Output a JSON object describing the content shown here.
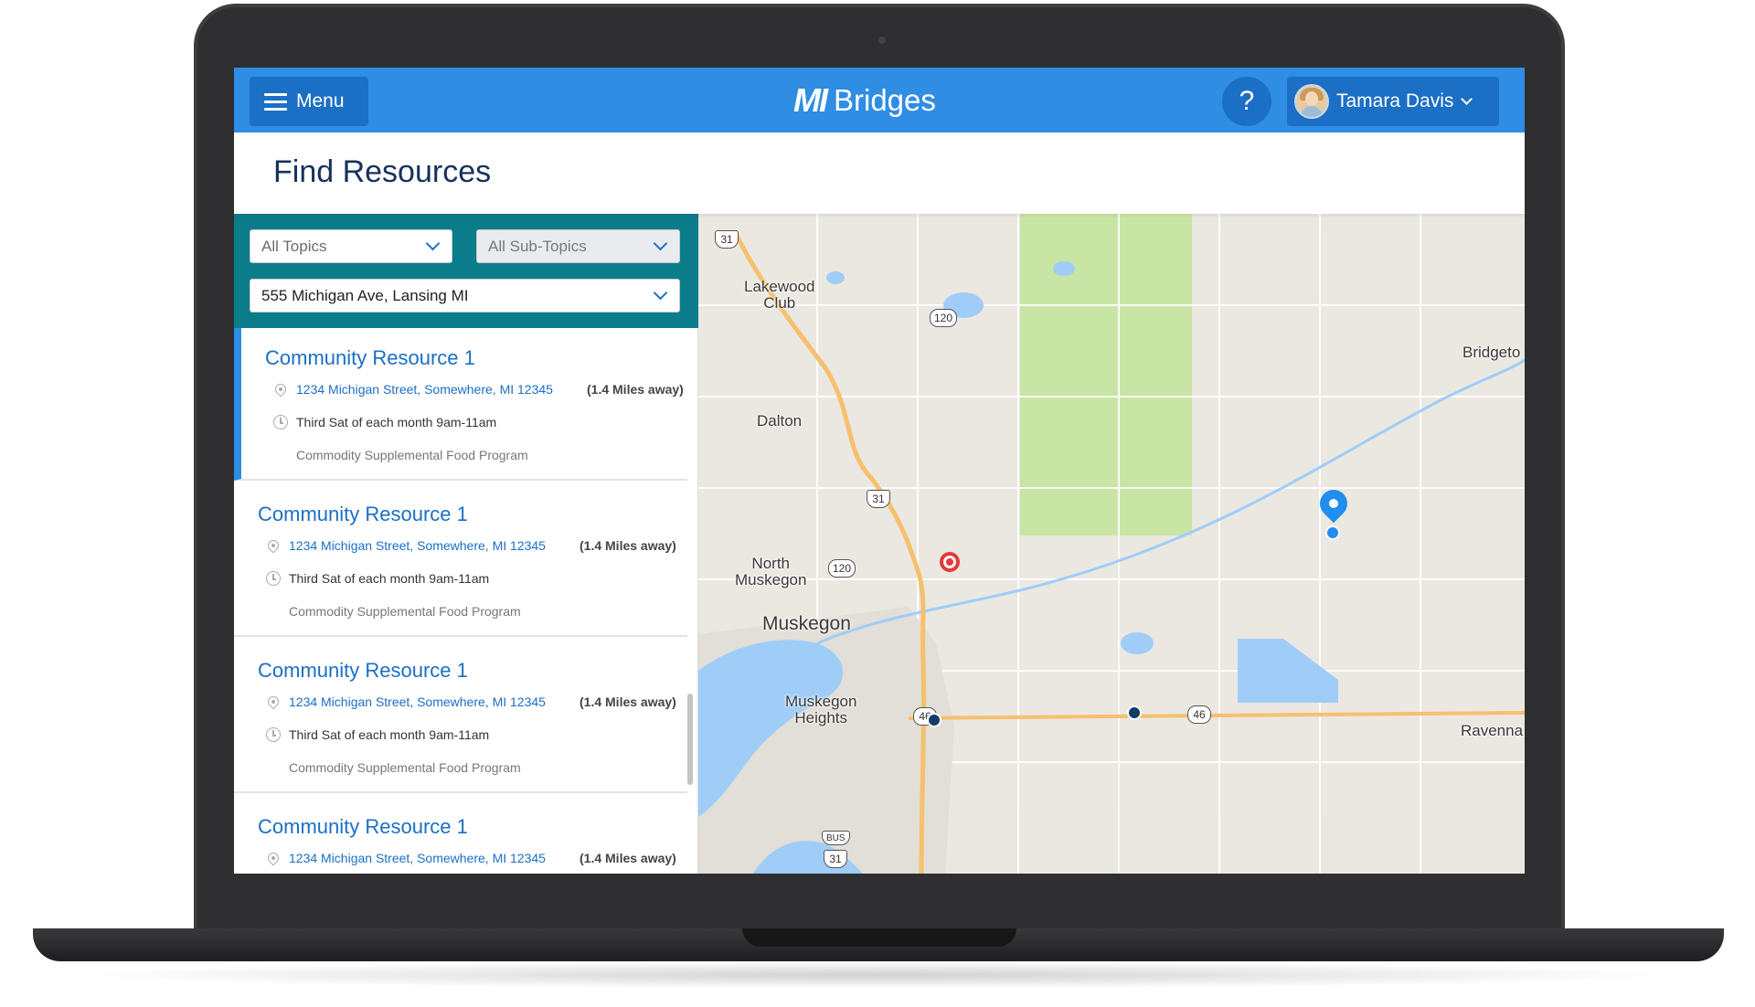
{
  "header": {
    "menu_label": "Menu",
    "logo_mark": "MI",
    "logo_text": "Bridges",
    "help_label": "?",
    "user_name": "Tamara Davis"
  },
  "page": {
    "title": "Find Resources"
  },
  "filters": {
    "topics": "All Topics",
    "subtopics": "All Sub-Topics",
    "address": "555 Michigan Ave, Lansing MI"
  },
  "results": [
    {
      "title": "Community Resource 1",
      "address": "1234 Michigan Street, Somewhere, MI 12345",
      "distance": "(1.4 Miles away)",
      "schedule": "Third Sat of each month 9am-11am",
      "program": "Commodity Supplemental Food Program",
      "active": true
    },
    {
      "title": "Community Resource 1",
      "address": "1234 Michigan Street, Somewhere, MI 12345",
      "distance": "(1.4 Miles away)",
      "schedule": "Third Sat of each month 9am-11am",
      "program": "Commodity Supplemental Food Program"
    },
    {
      "title": "Community Resource 1",
      "address": "1234 Michigan Street, Somewhere, MI 12345",
      "distance": "(1.4 Miles away)",
      "schedule": "Third Sat of each month 9am-11am",
      "program": "Commodity Supplemental Food Program"
    },
    {
      "title": "Community Resource 1",
      "address": "1234 Michigan Street, Somewhere, MI 12345",
      "distance": "(1.4 Miles away)"
    }
  ],
  "map": {
    "labels": {
      "lakewood_club": "Lakewood\nClub",
      "dalton": "Dalton",
      "north_muskegon": "North\nMuskegon",
      "muskegon": "Muskegon",
      "muskegon_heights": "Muskegon\nHeights",
      "bridgeton": "Bridgeto",
      "ravenna": "Ravenna"
    },
    "shields": {
      "us31_top": "31",
      "us31_mid": "31",
      "us31_bottom": "31",
      "m120_top": "120",
      "m120_mid": "120",
      "m46_left": "46",
      "m46_right": "46",
      "bus": "BUS"
    }
  },
  "colors": {
    "header": "#2f8de4",
    "header_button": "#1b6fc5",
    "filter_panel": "#0b7c89",
    "link": "#1b6fc5",
    "title": "#16325c",
    "map_land": "#ebe8e2",
    "map_park": "#c9e5a5",
    "map_water": "#9fcdf8",
    "map_highway": "#f6c06d"
  }
}
